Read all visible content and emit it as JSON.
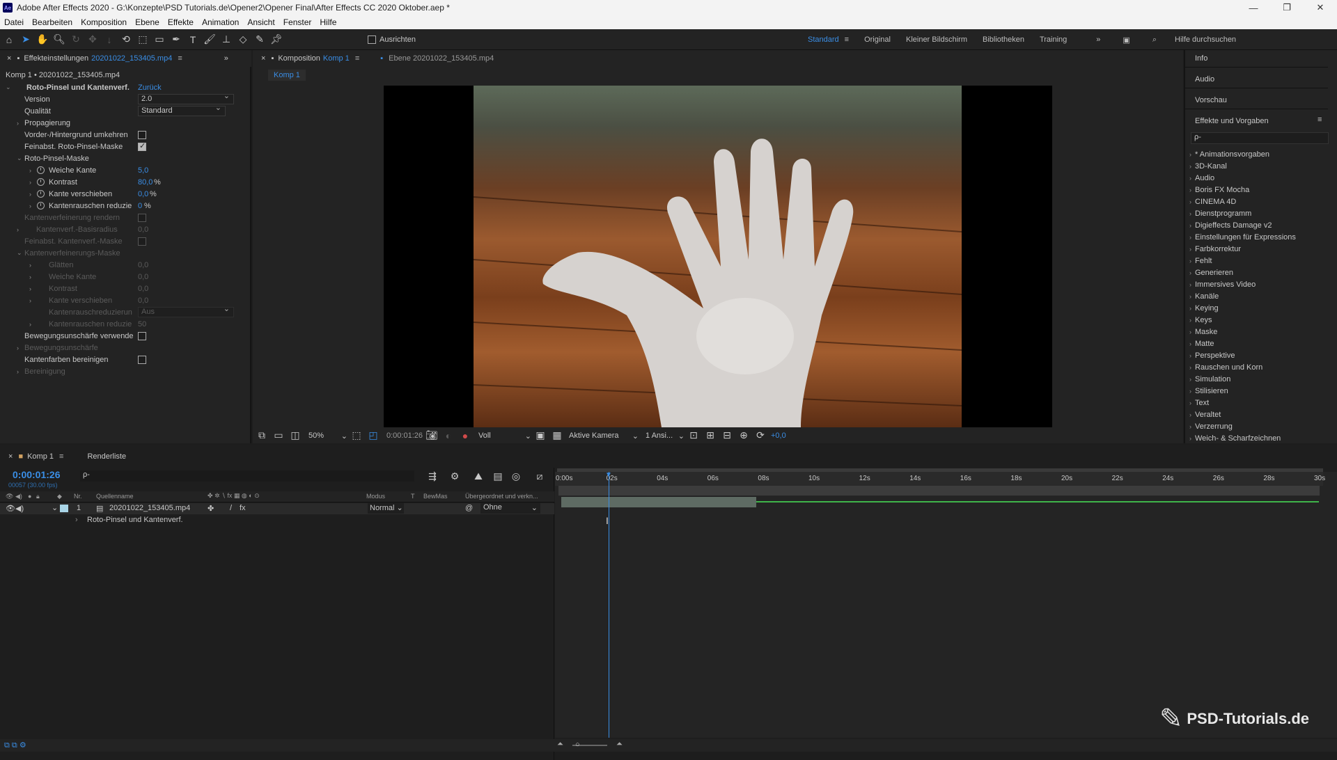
{
  "window": {
    "title": "Adobe After Effects 2020 - G:\\Konzepte\\PSD Tutorials.de\\Opener2\\Opener Final\\After Effects CC 2020 Oktober.aep *",
    "logo": "Ae",
    "min": "—",
    "max": "❐",
    "close": "✕"
  },
  "menu": [
    "Datei",
    "Bearbeiten",
    "Komposition",
    "Ebene",
    "Effekte",
    "Animation",
    "Ansicht",
    "Fenster",
    "Hilfe"
  ],
  "toolbar": {
    "align_label": "Ausrichten",
    "workspaces": [
      "Standard",
      "Original",
      "Kleiner Bildschirm",
      "Bibliotheken",
      "Training"
    ],
    "more": "»",
    "search_placeholder": "Hilfe durchsuchen"
  },
  "effects_panel": {
    "tab_label": "Effekteinstellungen",
    "tab_file": "20201022_153405.mp4",
    "subtitle": "Komp 1 • 20201022_153405.mp4",
    "effect_name": "Roto-Pinsel und Kantenverf.",
    "reset": "Zurück",
    "version_label": "Version",
    "version_value": "2.0",
    "quality_label": "Qualität",
    "quality_value": "Standard",
    "propagation": "Propagierung",
    "invert_fg": "Vorder-/Hintergrund umkehren",
    "refine_roto": "Feinabst. Roto-Pinsel-Maske",
    "roto_mask": "Roto-Pinsel-Maske",
    "feather_label": "Weiche Kante",
    "feather_value": "5,0",
    "contrast_label": "Kontrast",
    "contrast_value": "80,0",
    "shift_label": "Kante verschieben",
    "shift_value": "0,0",
    "chatter_label": "Kantenrauschen reduzie",
    "chatter_value": "0",
    "percent": "%",
    "edge_render": "Kantenverfeinerung rendern",
    "edge_radius": "Kantenverf.-Basisradius",
    "edge_radius_value": "0,0",
    "refine_edge": "Feinabst. Kantenverf.-Maske",
    "edge_mask": "Kantenverfeinerungs-Maske",
    "smooth": "Glätten",
    "smooth_value": "0,0",
    "soft_edge": "Weiche Kante",
    "soft_value": "0,0",
    "contrast2": "Kontrast",
    "contrast2_value": "0,0",
    "shift2": "Kante verschieben",
    "shift2_value": "0,0",
    "noise_reduce": "Kantenrauschreduzierun",
    "noise_value": "Aus",
    "noise_reduce2": "Kantenrauschen reduzie",
    "noise2_value": "50",
    "motion_blur": "Bewegungsunschärfe verwende",
    "motion_blur2": "Bewegungsunschärfe",
    "decontam": "Kantenfarben bereinigen",
    "cleanup": "Bereinigung"
  },
  "comp_panel": {
    "tab_prefix": "Komposition",
    "tab_name": "Komp 1",
    "layer_tab": "Ebene 20201022_153405.mp4",
    "breadcrumb": "Komp 1",
    "zoom": "50%",
    "timecode": "0:00:01:26",
    "resolution": "Voll",
    "camera": "Aktive Kamera",
    "views": "1 Ansi...",
    "exposure": "+0,0"
  },
  "right_panel": {
    "tabs": [
      "Info",
      "Audio",
      "Vorschau"
    ],
    "effects_title": "Effekte und Vorgaben",
    "search_placeholder": "ρ-",
    "categories": [
      "* Animationsvorgaben",
      "3D-Kanal",
      "Audio",
      "Boris FX Mocha",
      "CINEMA 4D",
      "Dienstprogramm",
      "Digieffects Damage v2",
      "Einstellungen für Expressions",
      "Farbkorrektur",
      "Fehlt",
      "Generieren",
      "Immersives Video",
      "Kanäle",
      "Keying",
      "Keys",
      "Maske",
      "Matte",
      "Perspektive",
      "Rauschen und Korn",
      "Simulation",
      "Stilisieren",
      "Text",
      "Veraltet",
      "Verzerrung",
      "Weich- & Scharfzeichnen"
    ]
  },
  "timeline": {
    "tab": "Komp 1",
    "render_tab": "Renderliste",
    "timecode": "0:00:01:26",
    "frames": "00057 (30.00 fps)",
    "search_placeholder": "ρ-",
    "col_nr": "Nr.",
    "col_name": "Quellenname",
    "col_mode": "Modus",
    "col_t": "T",
    "col_trkmat": "BewMas",
    "col_parent": "Übergeordnet und verkn...",
    "layer_num": "1",
    "layer_name": "20201022_153405.mp4",
    "layer_mode": "Normal",
    "layer_parent": "Ohne",
    "effect_row": "Roto-Pinsel und Kantenverf.",
    "ruler": [
      "0:00s",
      "02s",
      "04s",
      "06s",
      "08s",
      "10s",
      "12s",
      "14s",
      "16s",
      "18s",
      "20s",
      "22s",
      "24s",
      "26s",
      "28s",
      "30s"
    ]
  },
  "watermark": {
    "text": "PSD-Tutorials.de"
  },
  "colors": {
    "accent": "#3a8ee6",
    "panel": "#232323",
    "background": "#1d1d1d"
  }
}
